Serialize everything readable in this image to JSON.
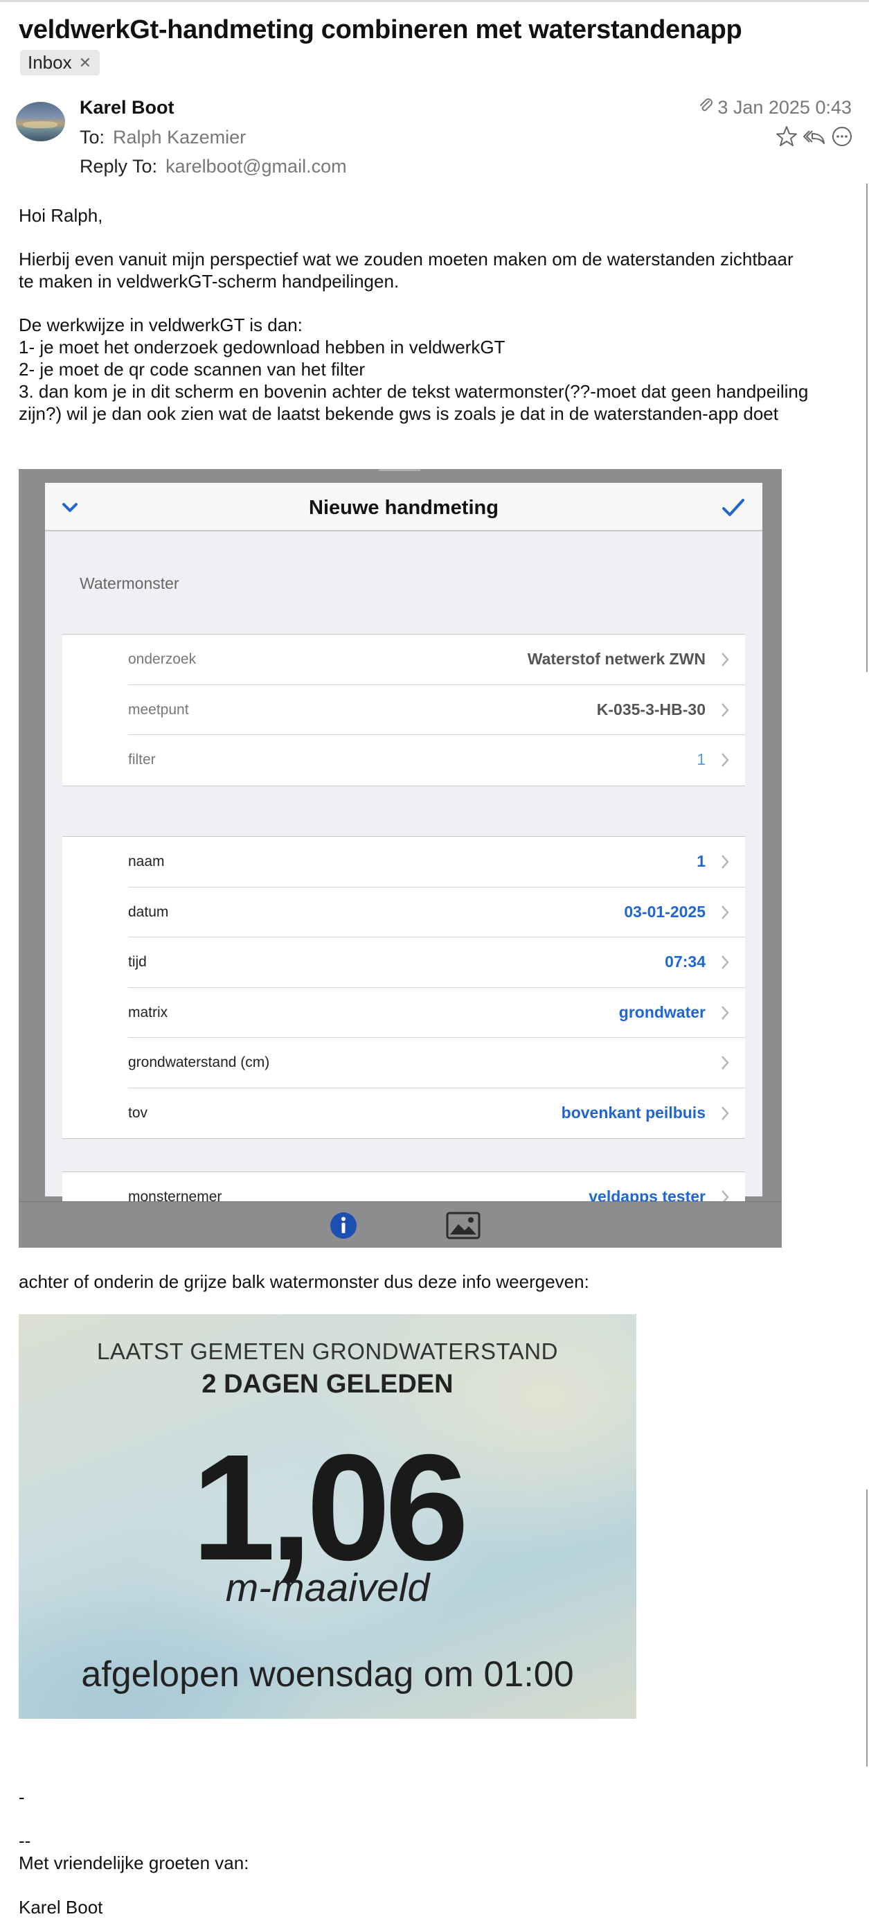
{
  "email": {
    "subject": "veldwerkGt-handmeting combineren met waterstandenapp",
    "tag": "Inbox",
    "from_name": "Karel Boot",
    "to_label": "To:",
    "to_value": "Ralph Kazemier",
    "reply_to_label": "Reply To:",
    "reply_to_value": "karelboot@gmail.com",
    "date": "3 Jan 2025 0:43",
    "icons": [
      "paperclip-icon",
      "star-icon",
      "reply-all-icon",
      "more-icon"
    ]
  },
  "body": {
    "greeting": "Hoi Ralph,",
    "para1_line1": "Hierbij even vanuit mijn perspectief wat we zouden moeten maken om de waterstanden zichtbaar",
    "para1_line2": "te maken in veldwerkGT-scherm handpeilingen.",
    "list_intro": "De werkwijze in veldwerkGT is dan:",
    "list_1": "1- je moet het onderzoek gedownload hebben in veldwerkGT",
    "list_2": "2- je moet de qr code scannen van het filter",
    "list_3a": "3. dan kom je in dit scherm en bovenin achter de tekst watermonster(??-moet dat geen handpeiling",
    "list_3b": "zijn?) wil je dan ook zien wat de laatst bekende gws is zoals je dat in de waterstanden-app doet",
    "caption2": "achter of onderin de grijze balk watermonster dus deze info weergeven:",
    "sig_dash": "-",
    "sig_dd": "--",
    "sig_greet": "Met vriendelijke groeten van:",
    "sig_name": "Karel Boot"
  },
  "form": {
    "title": "Nieuwe handmeting",
    "section": "Watermonster",
    "group1": [
      {
        "label": "onderzoek",
        "value": "Waterstof netwerk ZWN"
      },
      {
        "label": "meetpunt",
        "value": "K-035-3-HB-30"
      },
      {
        "label": "filter",
        "value": "1"
      }
    ],
    "group2": [
      {
        "label": "naam",
        "value": "1"
      },
      {
        "label": "datum",
        "value": "03-01-2025"
      },
      {
        "label": "tijd",
        "value": "07:34"
      },
      {
        "label": "matrix",
        "value": "grondwater"
      },
      {
        "label": "grondwaterstand (cm)",
        "value": ""
      },
      {
        "label": "tov",
        "value": "bovenkant peilbuis"
      }
    ],
    "group3": [
      {
        "label": "monsternemer",
        "value": "veldapps tester"
      }
    ]
  },
  "card": {
    "line1": "LAATST GEMETEN GRONDWATERSTAND",
    "line2": "2 DAGEN GELEDEN",
    "value": "1,06",
    "unit": "m-maaiveld",
    "when": "afgelopen woensdag om 01:00"
  },
  "colors": {
    "accent_blue": "#1f66d0",
    "toolbar_grey": "#8d8d90"
  }
}
